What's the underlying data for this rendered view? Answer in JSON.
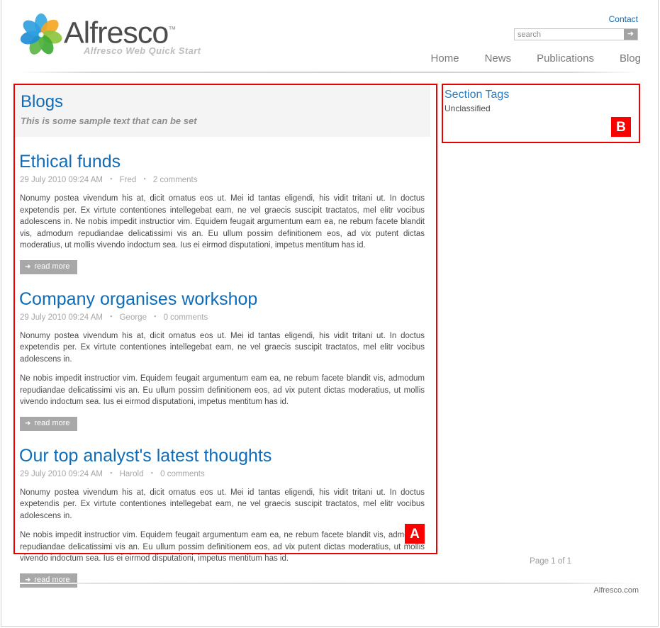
{
  "header": {
    "brand_name": "Alfresco",
    "brand_tm": "™",
    "tagline": "Alfresco Web Quick Start",
    "contact_label": "Contact",
    "search": {
      "placeholder": "search",
      "value": "",
      "button_glyph": "➜"
    },
    "nav": [
      {
        "label": "Home"
      },
      {
        "label": "News"
      },
      {
        "label": "Publications"
      },
      {
        "label": "Blog"
      }
    ]
  },
  "main": {
    "section_title": "Blogs",
    "section_subtitle": "This is some sample text that can be set",
    "read_more_label": "read more",
    "read_more_arrow": "➜",
    "meta_separator": "▪",
    "posts": [
      {
        "title": "Ethical funds",
        "date": "29 July 2010 09:24 AM",
        "author": "Fred",
        "comments": "2 comments",
        "paragraphs": [
          "Nonumy postea vivendum his at, dicit ornatus eos ut. Mei id tantas eligendi, his vidit tritani ut. In doctus expetendis per. Ex virtute contentiones intellegebat eam, ne vel graecis suscipit tractatos, mel elitr vocibus adolescens in. Ne nobis impedit instructior vim. Equidem feugait argumentum eam ea, ne rebum facete blandit vis, admodum repudiandae delicatissimi vis an. Eu ullum possim definitionem eos, ad vix putent dictas moderatius, ut mollis vivendo indoctum sea. Ius ei eirmod disputationi, impetus mentitum has id."
        ]
      },
      {
        "title": "Company organises workshop",
        "date": "29 July 2010 09:24 AM",
        "author": "George",
        "comments": "0 comments",
        "paragraphs": [
          "Nonumy postea vivendum his at, dicit ornatus eos ut. Mei id tantas eligendi, his vidit tritani ut. In doctus expetendis per. Ex virtute contentiones intellegebat eam, ne vel graecis suscipit tractatos, mel elitr vocibus adolescens in.",
          "Ne nobis impedit instructior vim. Equidem feugait argumentum eam ea, ne rebum facete blandit vis, admodum repudiandae delicatissimi vis an. Eu ullum possim definitionem eos, ad vix putent dictas moderatius, ut mollis vivendo indoctum sea. Ius ei eirmod disputationi, impetus mentitum has id."
        ]
      },
      {
        "title": "Our top analyst's latest thoughts",
        "date": "29 July 2010 09:24 AM",
        "author": "Harold",
        "comments": "0 comments",
        "paragraphs": [
          "Nonumy postea vivendum his at, dicit ornatus eos ut. Mei id tantas eligendi, his vidit tritani ut. In doctus expetendis per. Ex virtute contentiones intellegebat eam, ne vel graecis suscipit tractatos, mel elitr vocibus adolescens in.",
          "Ne nobis impedit instructior vim. Equidem feugait argumentum eam ea, ne rebum facete blandit vis, admodum repudiandae delicatissimi vis an. Eu ullum possim definitionem eos, ad vix putent dictas moderatius, ut mollis vivendo indoctum sea. Ius ei eirmod disputationi, impetus mentitum has id."
        ]
      }
    ],
    "pagination": "Page 1 of 1"
  },
  "sidebar": {
    "title": "Section Tags",
    "tags": [
      {
        "label": "Unclassified"
      }
    ]
  },
  "annotations": [
    {
      "id": "A",
      "label": "A"
    },
    {
      "id": "B",
      "label": "B"
    }
  ],
  "footer": {
    "link_label": "Alfresco.com"
  },
  "colors": {
    "brand_blue": "#0f6cb8",
    "annotation_red": "#fc0000",
    "button_gray": "#a8a8a8",
    "body_text": "#4a4a4a",
    "meta_text": "#a6a6a6"
  }
}
